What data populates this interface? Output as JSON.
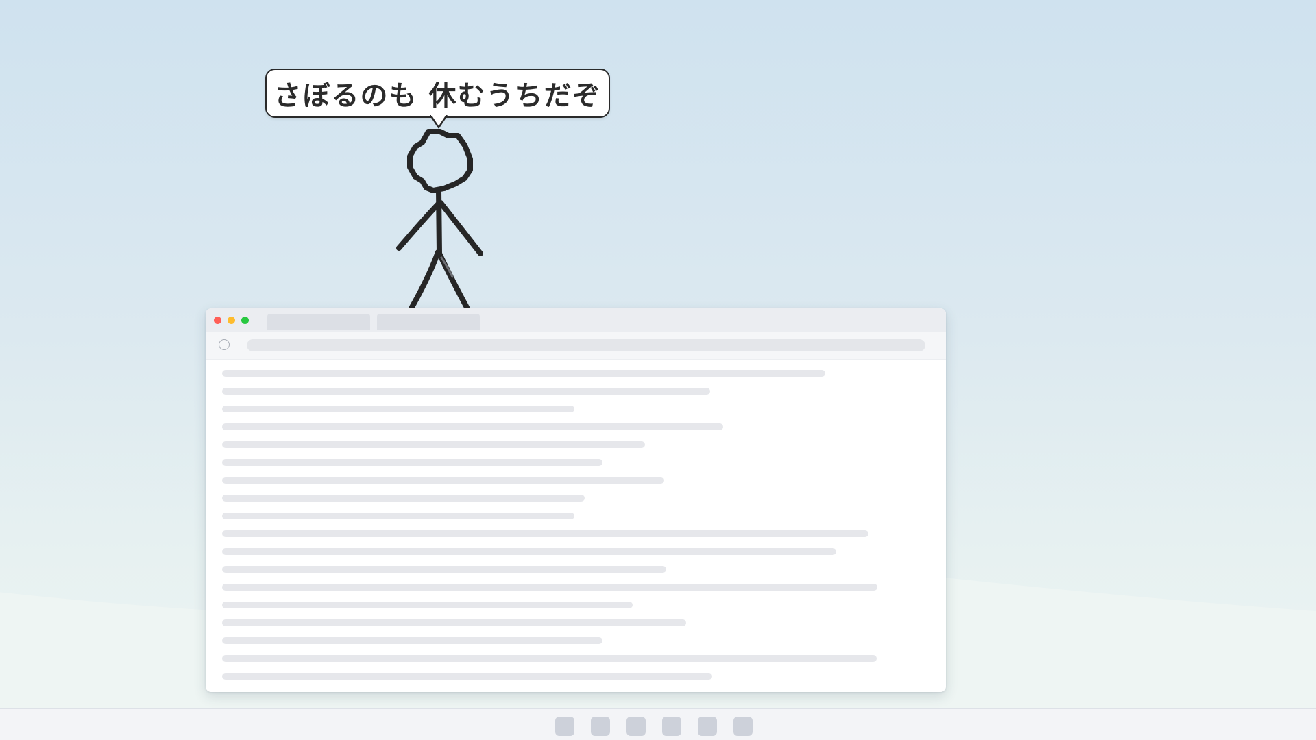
{
  "speech_bubble": {
    "text": "さぼるのも 休むうちだぞ"
  },
  "browser": {
    "traffic_lights": [
      "close",
      "minimize",
      "maximize"
    ],
    "tabs": [
      {
        "label": ""
      },
      {
        "label": ""
      }
    ],
    "address": "",
    "icons": {
      "reload": "reload-icon"
    }
  },
  "taskbar": {
    "app_icons": [
      "app-icon-1",
      "app-icon-2",
      "app-icon-3",
      "app-icon-4",
      "app-icon-5",
      "app-icon-6"
    ]
  },
  "colors": {
    "sky_top": "#cfe2ef",
    "sky_bottom": "#edf4f3",
    "traffic_close": "#ff5f57",
    "traffic_minimize": "#febc2e",
    "traffic_maximize": "#28c840",
    "placeholder": "#e6e7eb",
    "stroke": "#2a2a2a"
  }
}
